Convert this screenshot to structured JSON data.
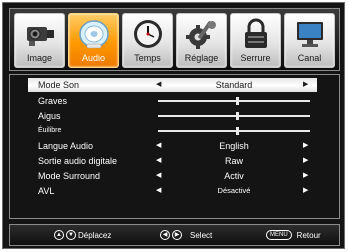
{
  "tabs": [
    {
      "label": "Image",
      "icon": "camcorder-icon",
      "active": false
    },
    {
      "label": "Audio",
      "icon": "speaker-icon",
      "active": true
    },
    {
      "label": "Temps",
      "icon": "clock-icon",
      "active": false
    },
    {
      "label": "Réglage",
      "icon": "settings-gear-icon",
      "active": false
    },
    {
      "label": "Serrure",
      "icon": "padlock-icon",
      "active": false
    },
    {
      "label": "Canal",
      "icon": "channel-monitor-icon",
      "active": false
    }
  ],
  "menu": {
    "mode_son": {
      "label": "Mode Son",
      "value": "Standard"
    },
    "graves": {
      "label": "Graves",
      "level": 0.52
    },
    "aigus": {
      "label": "Aigus",
      "level": 0.52
    },
    "equilibre": {
      "label": "Éuilibre",
      "level": 0.52
    },
    "langue_audio": {
      "label": "Langue Audio",
      "value": "English"
    },
    "sortie_audio": {
      "label": "Sortie audio digitale",
      "value": "Raw"
    },
    "mode_surround": {
      "label": "Mode Surround",
      "value": "Activ"
    },
    "avl": {
      "label": "AVL",
      "value": "Désactivé"
    }
  },
  "nav": {
    "move_label": "Déplacez",
    "select_label": "Select",
    "menu_key": "MENU",
    "back_label": "Retour"
  },
  "colors": {
    "active_tab": "#ff9900",
    "background": "#141414",
    "text": "#ffffff"
  }
}
